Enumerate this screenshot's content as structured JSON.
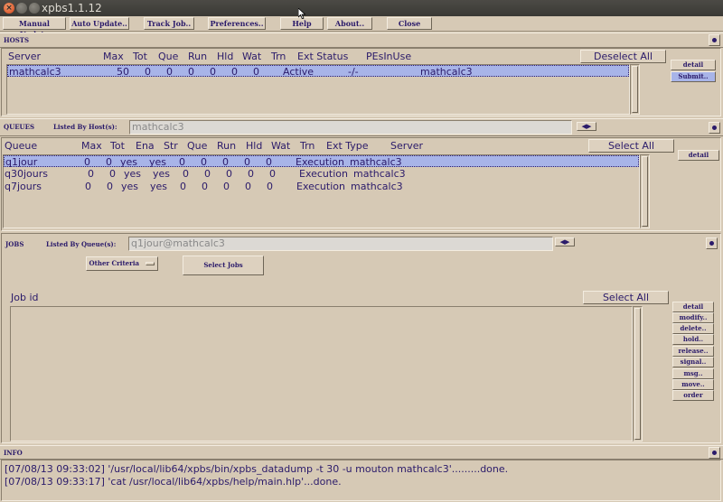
{
  "window": {
    "title": "xpbs1.1.12"
  },
  "menubar": {
    "items": [
      {
        "label": "Manual Update"
      },
      {
        "label": "Auto Update.."
      },
      {
        "label": "Track Job.."
      },
      {
        "label": "Preferences.."
      },
      {
        "label": "Help"
      },
      {
        "label": "About.."
      },
      {
        "label": "Close"
      }
    ]
  },
  "hosts": {
    "section_label": "HOSTS",
    "deselect_label": "Deselect All",
    "columns": [
      "Server",
      "Max",
      "Tot",
      "Que",
      "Run",
      "Hld",
      "Wat",
      "Trn",
      "Ext Status",
      "PEsInUse"
    ],
    "rows": [
      {
        "server": "mathcalc3",
        "max": "50",
        "tot": "0",
        "que": "0",
        "run": "0",
        "hld": "0",
        "wat": "0",
        "trn": "0",
        "status": "Active",
        "pes": "-/-",
        "pes_host": "mathcalc3"
      }
    ],
    "detail_label": "detail",
    "submit_label": "Submit.."
  },
  "queues": {
    "section_label": "QUEUES",
    "listed_by_label": "Listed By Host(s):",
    "listed_by_value": "mathcalc3",
    "select_all_label": "Select All",
    "detail_label": "detail",
    "columns": [
      "Queue",
      "Max",
      "Tot",
      "Ena",
      "Str",
      "Que",
      "Run",
      "Hld",
      "Wat",
      "Trn",
      "Ext Type",
      "Server"
    ],
    "rows": [
      {
        "queue": "q1jour",
        "max": "0",
        "tot": "0",
        "ena": "yes",
        "str": "yes",
        "que": "0",
        "run": "0",
        "hld": "0",
        "wat": "0",
        "trn": "0",
        "type": "Execution",
        "server": "mathcalc3"
      },
      {
        "queue": "q30jours",
        "max": "0",
        "tot": "0",
        "ena": "yes",
        "str": "yes",
        "que": "0",
        "run": "0",
        "hld": "0",
        "wat": "0",
        "trn": "0",
        "type": "Execution",
        "server": "mathcalc3"
      },
      {
        "queue": "q7jours",
        "max": "0",
        "tot": "0",
        "ena": "yes",
        "str": "yes",
        "que": "0",
        "run": "0",
        "hld": "0",
        "wat": "0",
        "trn": "0",
        "type": "Execution",
        "server": "mathcalc3"
      }
    ]
  },
  "jobs": {
    "section_label": "JOBS",
    "listed_by_label": "Listed By Queue(s):",
    "listed_by_value": "q1jour@mathcalc3",
    "other_criteria_label": "Other Criteria",
    "select_jobs_label": "Select Jobs",
    "jobid_label": "Job id",
    "select_all_label": "Select All",
    "actions": [
      "detail",
      "modify..",
      "delete..",
      "hold..",
      "release..",
      "signal..",
      "msg..",
      "move..",
      "order"
    ]
  },
  "info": {
    "section_label": "INFO",
    "lines": [
      "[07/08/13 09:33:02] '/usr/local/lib64/xpbs/bin/xpbs_datadump -t 30 -u mouton  mathcalc3'.........done.",
      "[07/08/13 09:33:17] 'cat /usr/local/lib64/xpbs/help/main.hlp'...done."
    ]
  },
  "colors": {
    "background": "#d6c9b5",
    "text": "#2a1a6a",
    "selection": "#a8b4e8"
  }
}
